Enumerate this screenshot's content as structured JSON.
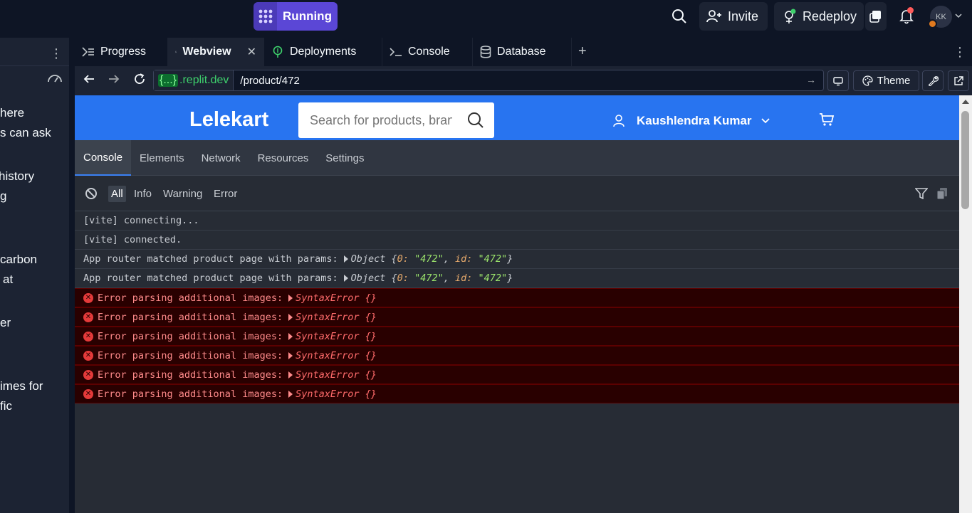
{
  "topbar": {
    "run_label": "Running",
    "invite_label": "Invite",
    "redeploy_label": "Redeploy",
    "avatar_initials": "KK"
  },
  "chat": {
    "lines": [
      "here",
      "s can ask",
      "history",
      "g",
      "carbon",
      "at",
      "er",
      "imes for",
      "fic"
    ]
  },
  "tabs": [
    {
      "label": "Progress",
      "icon": "progress-icon"
    },
    {
      "label": "Webview",
      "icon": "monitor-icon",
      "active": true
    },
    {
      "label": "Deployments",
      "icon": "deployments-icon"
    },
    {
      "label": "Console",
      "icon": "terminal-icon"
    },
    {
      "label": "Database",
      "icon": "database-icon"
    }
  ],
  "urlbar": {
    "host_brace": "{...}",
    "host": ".replit.dev",
    "path": "/product/472",
    "theme_label": "Theme"
  },
  "site": {
    "logo": "Lelekart",
    "search_placeholder": "Search for products, brands",
    "user_name": "Kaushlendra Kumar"
  },
  "devtools": {
    "tabs": [
      "Console",
      "Elements",
      "Network",
      "Resources",
      "Settings"
    ],
    "filters": [
      "All",
      "Info",
      "Warning",
      "Error"
    ],
    "logs": [
      {
        "text": "[vite] connecting..."
      },
      {
        "text": "[vite] connected."
      },
      {
        "text": "App router matched product page with params:",
        "obj": "Object",
        "k0": "0:",
        "v0": "\"472\"",
        "k1": "id:",
        "v1": "\"472\""
      },
      {
        "text": "App router matched product page with params:",
        "obj": "Object",
        "k0": "0:",
        "v0": "\"472\"",
        "k1": "id:",
        "v1": "\"472\""
      }
    ],
    "errors": [
      {
        "text": "Error parsing additional images:",
        "obj": "SyntaxError {}"
      },
      {
        "text": "Error parsing additional images:",
        "obj": "SyntaxError {}"
      },
      {
        "text": "Error parsing additional images:",
        "obj": "SyntaxError {}"
      },
      {
        "text": "Error parsing additional images:",
        "obj": "SyntaxError {}"
      },
      {
        "text": "Error parsing additional images:",
        "obj": "SyntaxError {}"
      },
      {
        "text": "Error parsing additional images:",
        "obj": "SyntaxError {}"
      }
    ]
  },
  "colors": {
    "accent": "#5b47d6",
    "site_header": "#2874f0",
    "error_bg": "#290000",
    "error_text": "#ff8b8b"
  }
}
